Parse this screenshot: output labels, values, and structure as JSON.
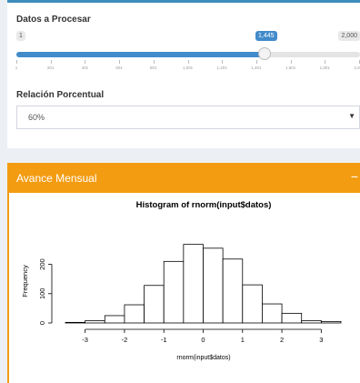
{
  "controls": {
    "slider_label": "Datos a Procesar",
    "slider_min_label": "1",
    "slider_max_label": "2,000",
    "slider_value_label": "1,445",
    "slider_fraction": 0.722,
    "slider_ticks": [
      "1",
      "201",
      "401",
      "601",
      "801",
      "1,001",
      "1,201",
      "1,401",
      "1,601",
      "1,801",
      "2,001"
    ],
    "select_label": "Relación Porcentual",
    "select_value": "60%"
  },
  "box2": {
    "title": "Avance Mensual",
    "collapse_symbol": "−"
  },
  "colors": {
    "primary": "#3c8dbc",
    "slider_blue": "#428bca",
    "warning_orange": "#f39c12"
  },
  "chart_data": {
    "type": "bar",
    "title": "Histogram of rnorm(input$datos)",
    "xlabel": "rnorm(input$datos)",
    "ylabel": "Frequency",
    "x_ticks": [
      "-3",
      "-2",
      "-1",
      "0",
      "1",
      "2",
      "3"
    ],
    "y_ticks": [
      "0",
      "100",
      "200"
    ],
    "xlim": [
      -3.5,
      3.5
    ],
    "ylim": [
      0,
      270
    ],
    "bin_edges": [
      -3.5,
      -3.0,
      -2.5,
      -2.0,
      -1.5,
      -1.0,
      -0.5,
      0.0,
      0.5,
      1.0,
      1.5,
      2.0,
      2.5,
      3.0,
      3.5
    ],
    "values": [
      2,
      8,
      25,
      62,
      128,
      210,
      268,
      255,
      218,
      130,
      65,
      33,
      8,
      5
    ]
  }
}
